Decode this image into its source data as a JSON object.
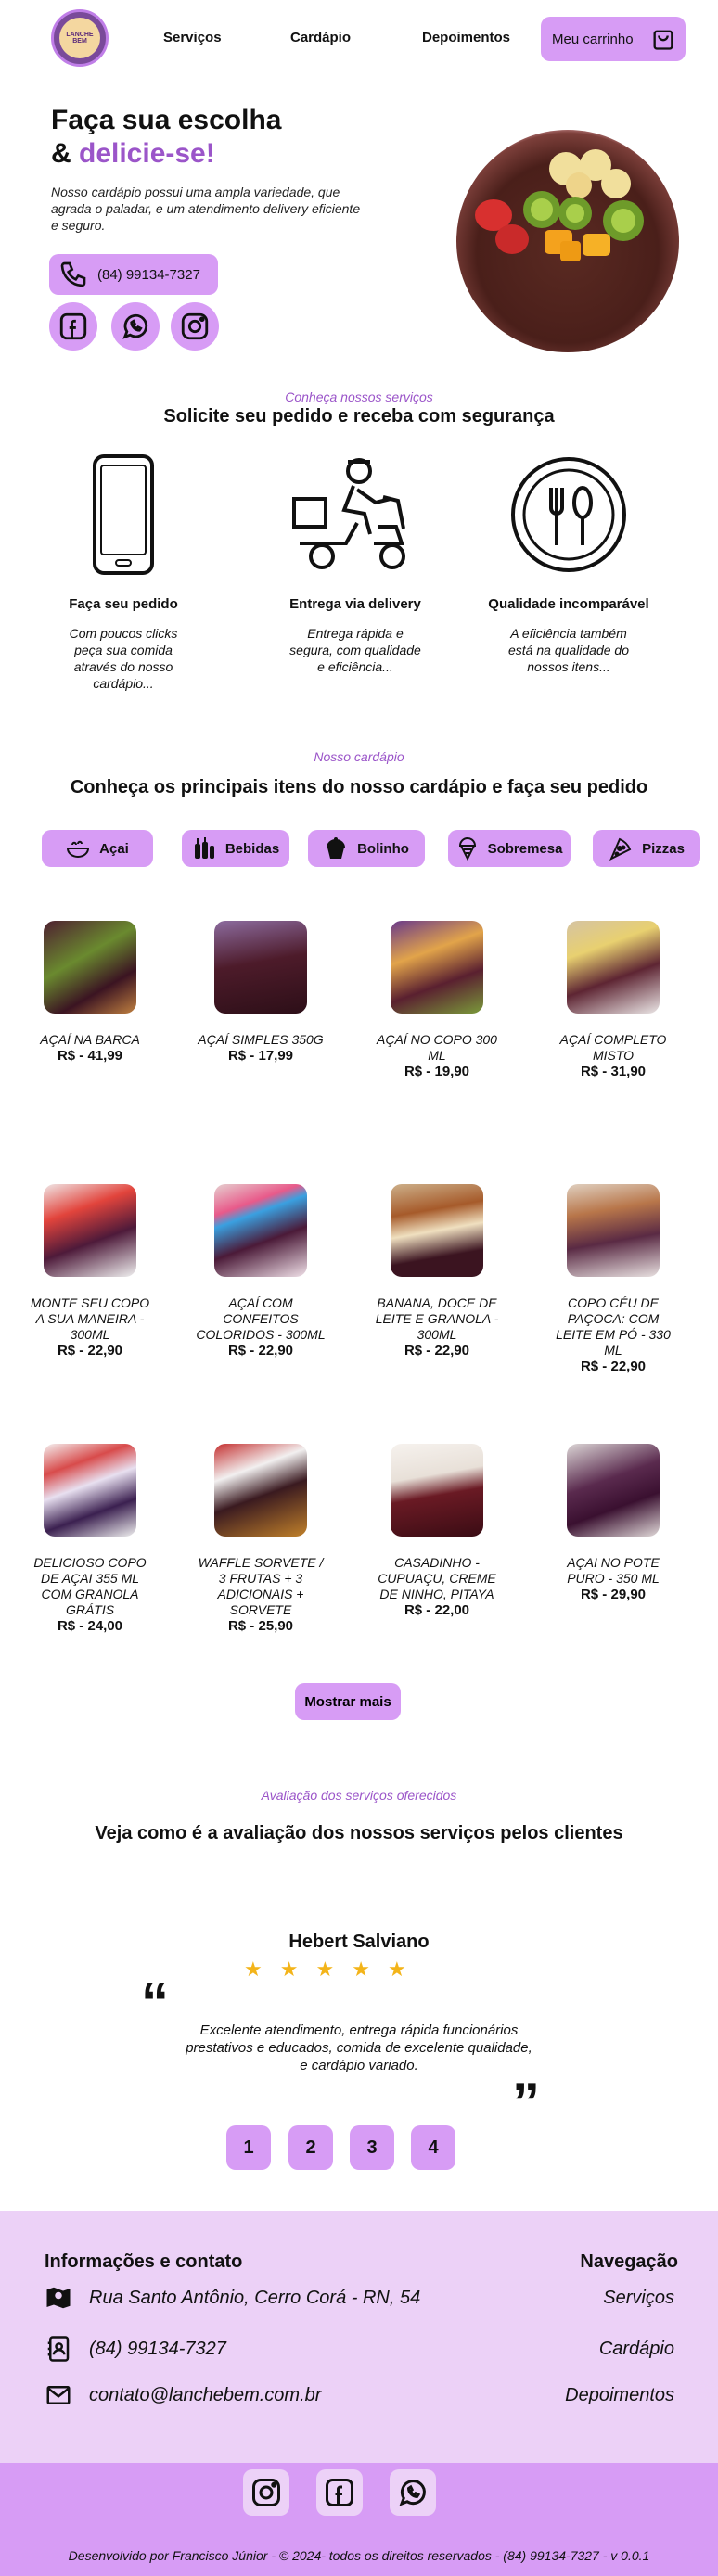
{
  "header": {
    "logo_text": "LANCHE BEM",
    "nav": [
      "Serviços",
      "Cardápio",
      "Depoimentos"
    ],
    "cart_label": "Meu carrinho"
  },
  "hero": {
    "title_line1": "Faça sua escolha",
    "title_amp": "& ",
    "title_accent": "delicie-se!",
    "description": "Nosso cardápio possui uma ampla variedade, que agrada o paladar, e um atendimento delivery eficiente e seguro.",
    "phone": "(84) 99134-7327"
  },
  "services": {
    "kicker": "Conheça nossos serviços",
    "title": "Solicite seu pedido e receba com segurança",
    "items": [
      {
        "title": "Faça seu pedido",
        "text": "Com poucos clicks peça sua comida através do nosso cardápio..."
      },
      {
        "title": "Entrega via delivery",
        "text": "Entrega rápida e segura, com qualidade e eficiência..."
      },
      {
        "title": "Qualidade incomparável",
        "text": "A eficiência também está na qualidade do nossos itens..."
      }
    ]
  },
  "menu": {
    "kicker": "Nosso cardápio",
    "title": "Conheça os principais itens do nosso cardápio e faça seu pedido",
    "categories": [
      "Açai",
      "Bebidas",
      "Bolinho",
      "Sobremesa",
      "Pizzas"
    ],
    "items": [
      {
        "name": "AÇAÍ NA BARCA",
        "price": "R$ - 41,99"
      },
      {
        "name": "AÇAÍ SIMPLES 350G",
        "price": "R$ - 17,99"
      },
      {
        "name": "AÇAÍ NO COPO 300 ML",
        "price": "R$ - 19,90"
      },
      {
        "name": "AÇAÍ COMPLETO MISTO",
        "price": "R$ - 31,90"
      },
      {
        "name": "MONTE SEU COPO A SUA MANEIRA - 300ML",
        "price": "R$ - 22,90"
      },
      {
        "name": "AÇAÍ COM CONFEITOS COLORIDOS - 300ML",
        "price": "R$ - 22,90"
      },
      {
        "name": "BANANA, DOCE DE LEITE E GRANOLA - 300ML",
        "price": "R$ - 22,90"
      },
      {
        "name": "COPO CÉU DE PAÇOCA: COM LEITE EM PÓ - 330 ML",
        "price": "R$ - 22,90"
      },
      {
        "name": "DELICIOSO COPO DE AÇAI 355 ML COM GRANOLA GRÁTIS",
        "price": "R$ - 24,00"
      },
      {
        "name": "WAFFLE SORVETE / 3 FRUTAS + 3 ADICIONAIS + SORVETE",
        "price": "R$ - 25,90"
      },
      {
        "name": "CASADINHO - CUPUAÇU, CREME DE NINHO, PITAYA",
        "price": "R$ - 22,00"
      },
      {
        "name": "AÇAI NO POTE PURO - 350 ML",
        "price": "R$ - 29,90"
      }
    ],
    "more_label": "Mostrar mais"
  },
  "reviews": {
    "kicker": "Avaliação dos serviços oferecidos",
    "title": "Veja como é a avaliação dos nossos serviços pelos clientes",
    "reviewer": "Hebert Salviano",
    "rating": 5,
    "text": "Excelente atendimento, entrega rápida funcionários prestativos e educados, comida de excelente qualidade, e cardápio variado.",
    "pages": [
      "1",
      "2",
      "3",
      "4"
    ]
  },
  "footer": {
    "info_title": "Informações e contato",
    "address": "Rua Santo Antônio, Cerro Corá - RN, 54",
    "phone": "(84) 99134-7327",
    "email": "contato@lanchebem.com.br",
    "nav_title": "Navegação",
    "nav_links": [
      "Serviços",
      "Cardápio",
      "Depoimentos"
    ],
    "copyright": "Desenvolvido por Francisco Júnior - © 2024- todos os direitos reservados - (84) 99134-7327 - v 0.0.1"
  },
  "colors": {
    "accent": "#d79cf5",
    "accent_text": "#9b55c9",
    "footer_light": "#ecd1f7"
  }
}
